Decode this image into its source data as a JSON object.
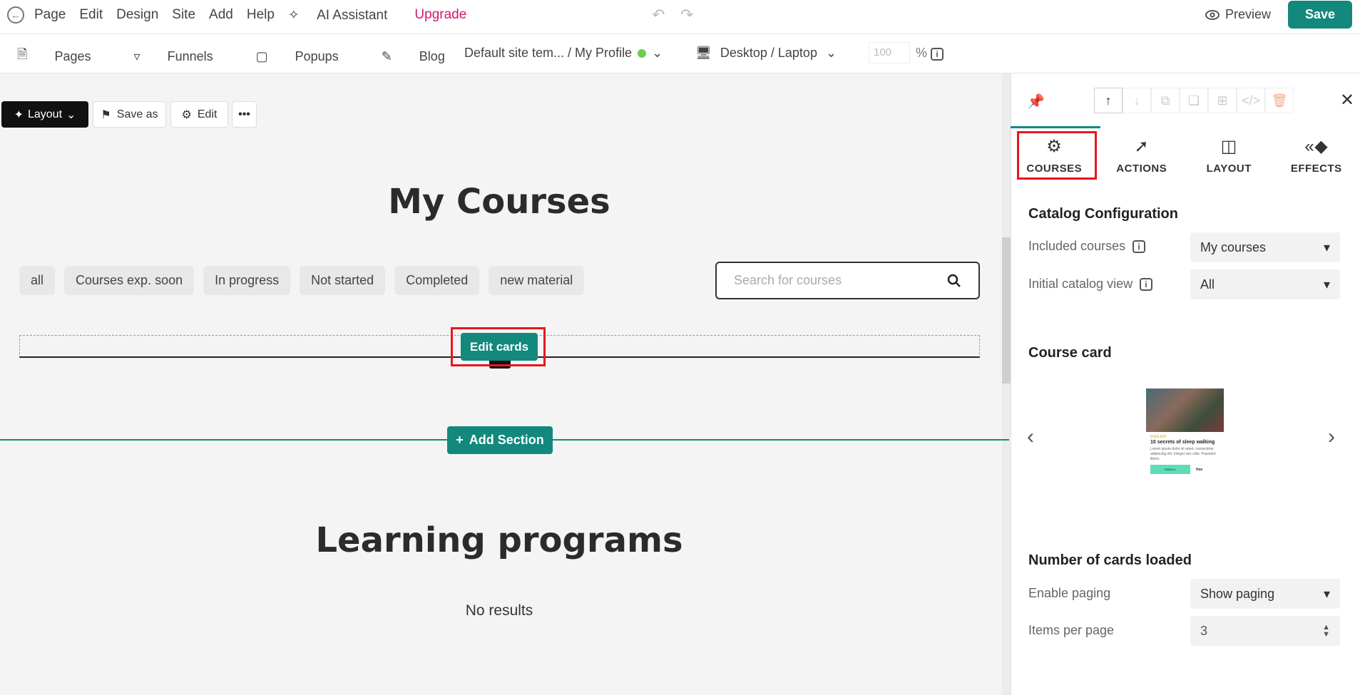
{
  "topbar": {
    "menu": [
      "Page",
      "Edit",
      "Design",
      "Site",
      "Add",
      "Help"
    ],
    "ai_assistant": "AI Assistant",
    "upgrade": "Upgrade",
    "preview": "Preview",
    "save": "Save"
  },
  "subbar": {
    "nav": [
      "Pages",
      "Funnels",
      "Popups",
      "Blog"
    ],
    "template": "Default site tem... / My Profile",
    "device": "Desktop / Laptop",
    "zoom_placeholder": "100",
    "percent": "%"
  },
  "canvas_toolbar": {
    "layout": "Layout",
    "save_as": "Save as",
    "edit": "Edit",
    "more": "•••"
  },
  "courses_section": {
    "title": "My Courses",
    "filters": [
      "all",
      "Courses exp. soon",
      "In progress",
      "Not started",
      "Completed",
      "new material"
    ],
    "search_placeholder": "Search for courses",
    "edit_cards": "Edit cards"
  },
  "add_section": "Add Section",
  "programs_section": {
    "title": "Learning programs",
    "empty": "No results"
  },
  "panel": {
    "tabs": [
      "COURSES",
      "ACTIONS",
      "LAYOUT",
      "EFFECTS"
    ],
    "catalog": {
      "title": "Catalog Configuration",
      "included_label": "Included courses",
      "included_value": "My courses",
      "initial_label": "Initial catalog view",
      "initial_value": "All"
    },
    "course_card": {
      "title": "Course card",
      "preview_tag": "ENGLISH",
      "preview_title": "10 secrets of sleep walking",
      "preview_text": "Lorem ipsum dolor sit amet, consectetur adipiscing elit. Integer nec odio. Praesent libero.",
      "preview_button": "ENROLL",
      "preview_price": "free"
    },
    "cards_loaded": {
      "title": "Number of cards loaded",
      "paging_label": "Enable paging",
      "paging_value": "Show paging",
      "items_label": "Items per page",
      "items_value": "3"
    }
  },
  "colors": {
    "accent": "#12897c",
    "highlight": "#e8161b",
    "ai": "#9a4ad9",
    "upgrade": "#d2186b"
  }
}
